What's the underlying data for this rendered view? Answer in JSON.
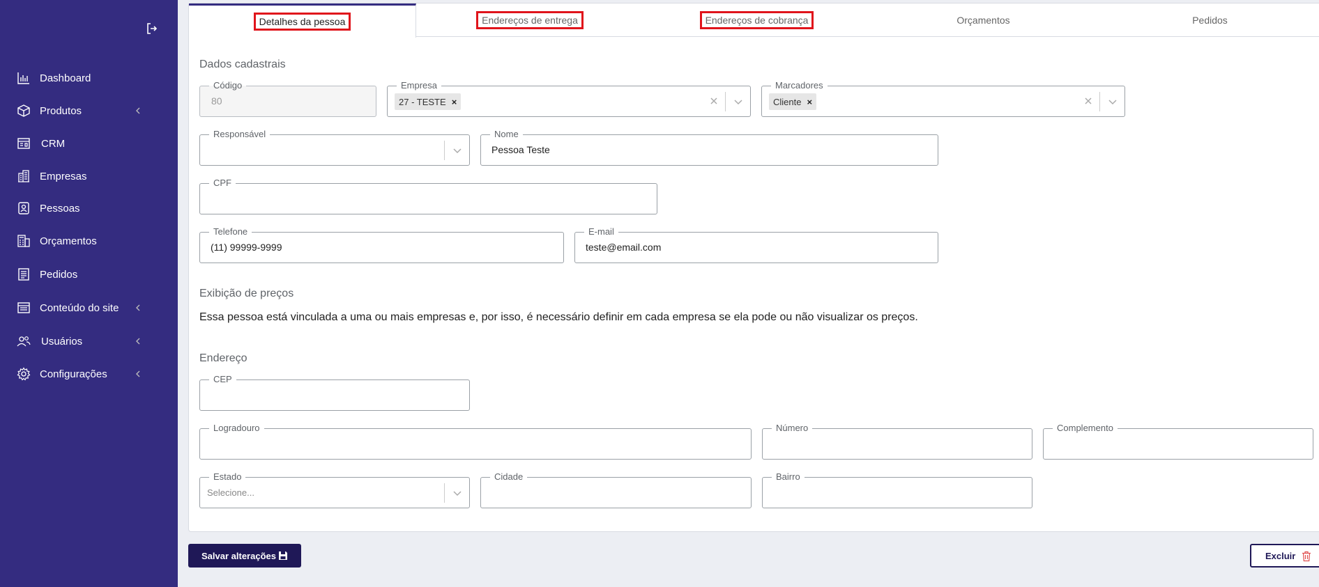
{
  "sidebar": {
    "items": [
      {
        "label": "Dashboard",
        "icon": "chart-icon",
        "has_chevron": false
      },
      {
        "label": "Produtos",
        "icon": "box-icon",
        "has_chevron": true
      },
      {
        "label": "CRM",
        "icon": "crm-icon",
        "has_chevron": false
      },
      {
        "label": "Empresas",
        "icon": "building-icon",
        "has_chevron": false
      },
      {
        "label": "Pessoas",
        "icon": "person-icon",
        "has_chevron": false
      },
      {
        "label": "Orçamentos",
        "icon": "calculator-icon",
        "has_chevron": false
      },
      {
        "label": "Pedidos",
        "icon": "document-icon",
        "has_chevron": false
      },
      {
        "label": "Conteúdo do site",
        "icon": "site-icon",
        "has_chevron": true
      },
      {
        "label": "Usuários",
        "icon": "users-icon",
        "has_chevron": true
      },
      {
        "label": "Configurações",
        "icon": "gear-icon",
        "has_chevron": true
      }
    ]
  },
  "tabs": [
    {
      "label": "Detalhes da pessoa",
      "active": true,
      "highlighted": true
    },
    {
      "label": "Endereços de entrega",
      "active": false,
      "highlighted": true
    },
    {
      "label": "Endereços de cobrança",
      "active": false,
      "highlighted": true
    },
    {
      "label": "Orçamentos",
      "active": false,
      "highlighted": false
    },
    {
      "label": "Pedidos",
      "active": false,
      "highlighted": false
    }
  ],
  "sections": {
    "dados": "Dados cadastrais",
    "precos": "Exibição de preços",
    "precos_info": "Essa pessoa está vinculada a uma ou mais empresas e, por isso, é necessário definir em cada empresa se ela pode ou não visualizar os preços.",
    "endereco": "Endereço"
  },
  "fields": {
    "codigo": {
      "label": "Código",
      "value": "80"
    },
    "empresa": {
      "label": "Empresa",
      "chip": "27 - TESTE"
    },
    "marcadores": {
      "label": "Marcadores",
      "chip": "Cliente"
    },
    "responsavel": {
      "label": "Responsável",
      "value": ""
    },
    "nome": {
      "label": "Nome",
      "value": "Pessoa Teste"
    },
    "cpf": {
      "label": "CPF",
      "value": ""
    },
    "telefone": {
      "label": "Telefone",
      "value": "(11) 99999-9999"
    },
    "email": {
      "label": "E-mail",
      "value": "teste@email.com"
    },
    "cep": {
      "label": "CEP",
      "value": ""
    },
    "logradouro": {
      "label": "Logradouro",
      "value": ""
    },
    "numero": {
      "label": "Número",
      "value": ""
    },
    "complemento": {
      "label": "Complemento",
      "value": ""
    },
    "estado": {
      "label": "Estado",
      "placeholder": "Selecione..."
    },
    "cidade": {
      "label": "Cidade",
      "value": ""
    },
    "bairro": {
      "label": "Bairro",
      "value": ""
    }
  },
  "buttons": {
    "save": "Salvar alterações",
    "delete": "Excluir"
  },
  "colors": {
    "sidebar": "#342c80",
    "primary_button": "#1f1857",
    "highlight": "#e0141b",
    "delete_icon": "#e05050"
  }
}
